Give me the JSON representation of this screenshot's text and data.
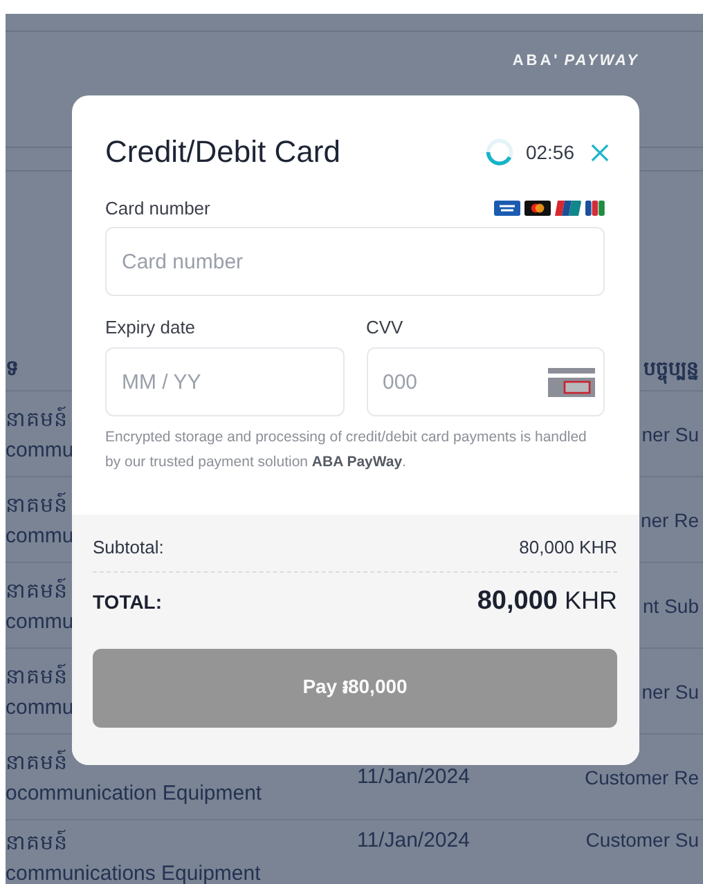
{
  "background": {
    "logo": {
      "brand": "ABA'",
      "product": "PAYWAY"
    },
    "table": {
      "header": {
        "column_1": "ទ",
        "column_3": "បច្ចុប្បន្ន"
      },
      "rows": [
        {
          "column_1": [
            "នាគមន៍",
            "commu"
          ],
          "column_2": "",
          "column_3": "ner Su"
        },
        {
          "column_1": [
            "នាគមន៍",
            "commu"
          ],
          "column_2": "",
          "column_3": "ner Re"
        },
        {
          "column_1": [
            "នាគមន៍",
            "commu"
          ],
          "column_2": "",
          "column_3": "nt Sub"
        },
        {
          "column_1": [
            "នាគមន៍",
            "commu"
          ],
          "column_2": "",
          "column_3": "ner Su"
        },
        {
          "column_1": [
            "នាគមន៍",
            "ocommunication Equipment"
          ],
          "column_2": "11/Jan/2024",
          "column_3": "Customer Re"
        },
        {
          "column_1": [
            "នាគមន៍",
            "communications Equipment"
          ],
          "column_2": "11/Jan/2024",
          "column_3": "Customer Su"
        }
      ]
    }
  },
  "dialog": {
    "title": "Credit/Debit Card",
    "timer": "02:56",
    "card_number": {
      "label": "Card number",
      "placeholder": "Card number"
    },
    "expiry": {
      "label": "Expiry date",
      "placeholder": "MM / YY"
    },
    "cvv": {
      "label": "CVV",
      "placeholder": "000"
    },
    "note": "Encrypted storage and processing of credit/debit card payments is handled by our trusted payment solution **ABA PayWay**.",
    "subtotal": {
      "label": "Subtotal:",
      "value": "80,000 KHR"
    },
    "total": {
      "label": "TOTAL:",
      "value": "**80,000** KHR"
    },
    "pay_button": {
      "label": "Pay ៛80,000",
      "disabled": true
    }
  }
}
